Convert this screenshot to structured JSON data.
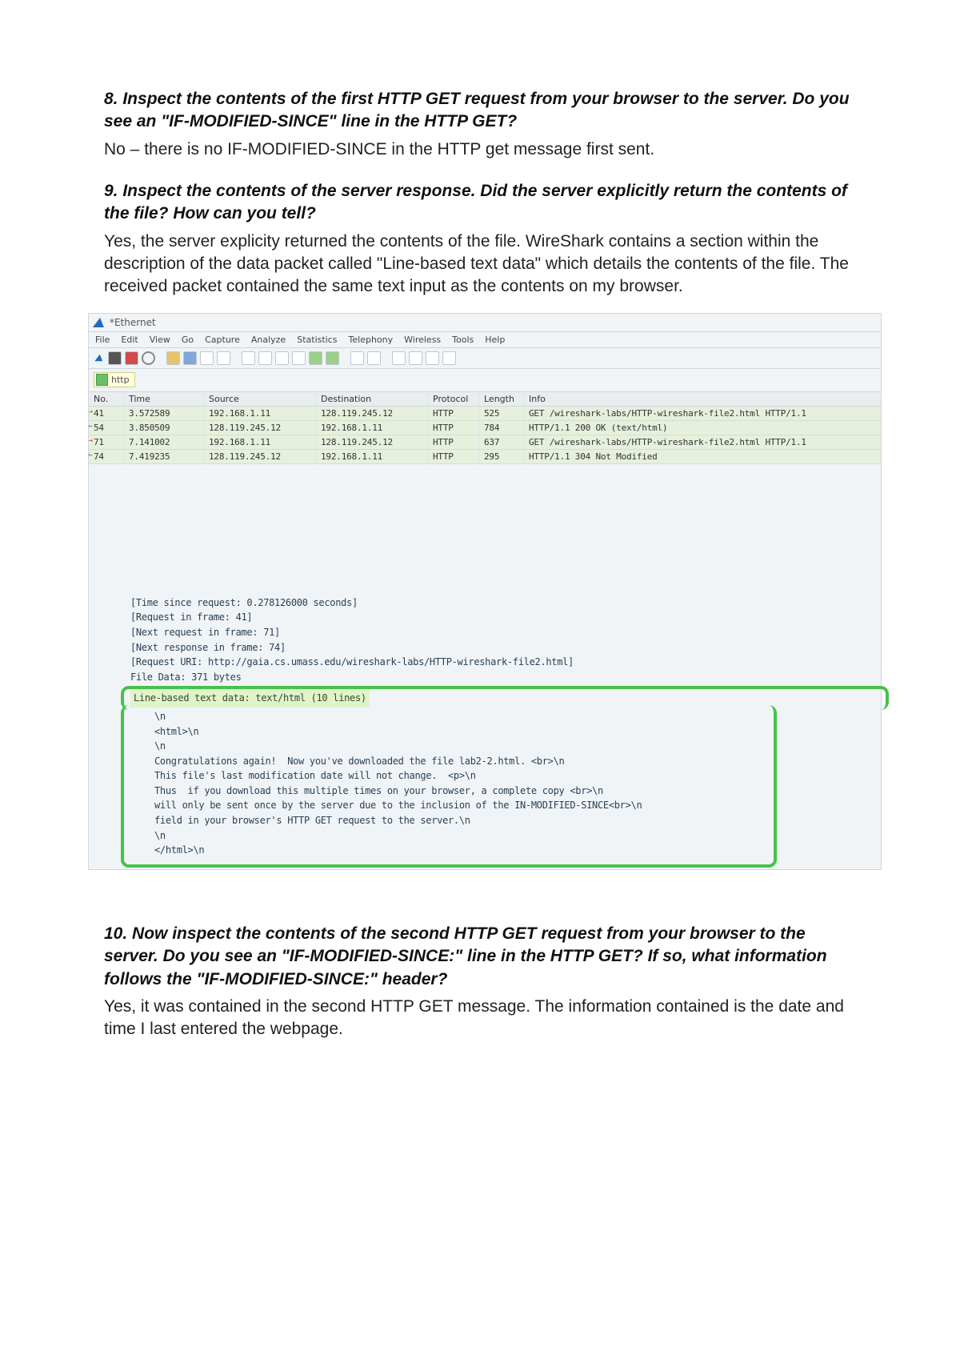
{
  "questions": {
    "q8": {
      "prompt": "8. Inspect the contents of the first HTTP GET request from your browser to the server. Do you see an \"IF-MODIFIED-SINCE\" line in the HTTP GET?",
      "answer": "No – there is no IF-MODIFIED-SINCE in the HTTP get message first sent."
    },
    "q9": {
      "prompt": "9. Inspect the contents of the server response. Did the server explicitly return the contents of the file? How can you tell?",
      "answer": "Yes, the server explicity returned the contents of the file. WireShark contains a section within the description of the data packet called \"Line-based text data\" which details the contents of the file. The received packet contained the same text input as the contents on my browser."
    },
    "q10": {
      "prompt": "10. Now inspect the contents of the second HTTP GET request from your browser to the server. Do you see an \"IF-MODIFIED-SINCE:\" line in the HTTP GET? If so, what information follows the \"IF-MODIFIED-SINCE:\" header?",
      "answer": "Yes, it was contained in the second HTTP GET message. The information contained is the date and time I last entered the webpage."
    }
  },
  "wireshark": {
    "title": "*Ethernet",
    "menu": [
      "File",
      "Edit",
      "View",
      "Go",
      "Capture",
      "Analyze",
      "Statistics",
      "Telephony",
      "Wireless",
      "Tools",
      "Help"
    ],
    "filter": "http",
    "columns": [
      "No.",
      "Time",
      "Source",
      "Destination",
      "Protocol",
      "Length",
      "Info"
    ],
    "rows": [
      {
        "no": "41",
        "dir": "out",
        "time": "3.572589",
        "src": "192.168.1.11",
        "dst": "128.119.245.12",
        "proto": "HTTP",
        "len": "525",
        "info": "GET /wireshark-labs/HTTP-wireshark-file2.html HTTP/1.1"
      },
      {
        "no": "54",
        "dir": "in",
        "time": "3.850509",
        "src": "128.119.245.12",
        "dst": "192.168.1.11",
        "proto": "HTTP",
        "len": "784",
        "info": "HTTP/1.1 200 OK  (text/html)"
      },
      {
        "no": "71",
        "dir": "out",
        "time": "7.141002",
        "src": "192.168.1.11",
        "dst": "128.119.245.12",
        "proto": "HTTP",
        "len": "637",
        "info": "GET /wireshark-labs/HTTP-wireshark-file2.html HTTP/1.1"
      },
      {
        "no": "74",
        "dir": "in",
        "time": "7.419235",
        "src": "128.119.245.12",
        "dst": "192.168.1.11",
        "proto": "HTTP",
        "len": "295",
        "info": "HTTP/1.1 304 Not Modified"
      }
    ],
    "details": {
      "time_since": "[Time since request: 0.278126000 seconds]",
      "req_frame": "[Request in frame: 41]",
      "next_req": "[Next request in frame: 71]",
      "next_resp": "[Next response in frame: 74]",
      "req_uri": "[Request URI: http://gaia.cs.umass.edu/wireshark-labs/HTTP-wireshark-file2.html]",
      "file_data": "File Data: 371 bytes"
    },
    "linebased": {
      "header": "Line-based text data: text/html (10 lines)",
      "lines": [
        "\\n",
        "<html>\\n",
        "\\n",
        "Congratulations again!  Now you've downloaded the file lab2-2.html. <br>\\n",
        "This file's last modification date will not change.  <p>\\n",
        "Thus  if you download this multiple times on your browser, a complete copy <br>\\n",
        "will only be sent once by the server due to the inclusion of the IN-MODIFIED-SINCE<br>\\n",
        "field in your browser's HTTP GET request to the server.\\n",
        "\\n",
        "</html>\\n"
      ]
    }
  }
}
